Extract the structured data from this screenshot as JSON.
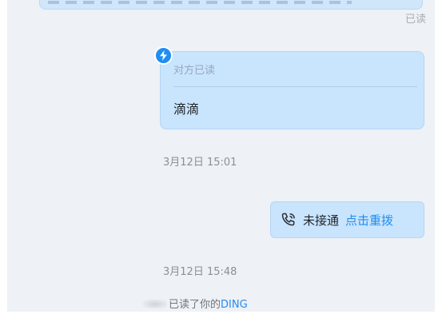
{
  "messages": {
    "top_bubble": {
      "status": "已读"
    },
    "ding_card": {
      "status": "对方已读",
      "text": "滴滴"
    },
    "timestamp_1": "3月12日 15:01",
    "call": {
      "status": "未接通",
      "redial_label": "点击重拨"
    },
    "timestamp_2": "3月12日 15:48",
    "system_notice": {
      "text": "已读了你的",
      "link": "DING"
    }
  },
  "colors": {
    "background": "#eef1f5",
    "bubble": "#c9e4fd",
    "accent": "#1f8df3"
  },
  "icons": {
    "ding_badge": "lightning-icon",
    "call": "phone-icon"
  }
}
